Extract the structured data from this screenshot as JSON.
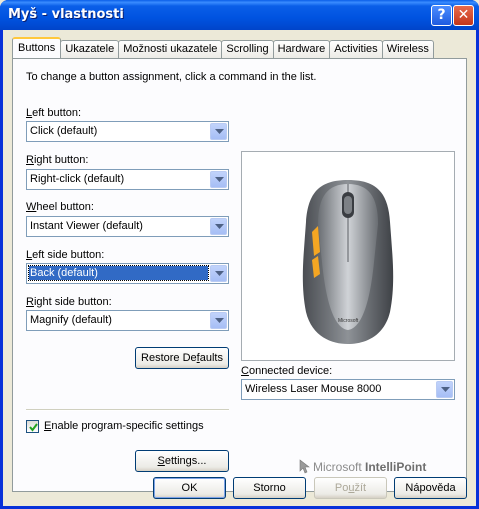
{
  "window": {
    "title": "Myš - vlastnosti",
    "help_glyph": "?",
    "close_glyph": "✕"
  },
  "tabs": [
    {
      "label": "Buttons",
      "active": true
    },
    {
      "label": "Ukazatele"
    },
    {
      "label": "Možnosti ukazatele"
    },
    {
      "label": "Scrolling"
    },
    {
      "label": "Hardware"
    },
    {
      "label": "Activities"
    },
    {
      "label": "Wireless"
    }
  ],
  "buttons_tab": {
    "hint": "To change a button assignment, click a command in the list.",
    "left_button": {
      "label_u": "L",
      "label_rest": "eft button:",
      "value": "Click (default)"
    },
    "right_button": {
      "label_u": "R",
      "label_rest": "ight button:",
      "value": "Right-click (default)"
    },
    "wheel_button": {
      "label_u": "W",
      "label_rest": "heel button:",
      "value": "Instant Viewer (default)"
    },
    "left_side_button": {
      "label_u": "L",
      "label_rest": "eft side button:",
      "value": "Back (default)"
    },
    "right_side_button": {
      "label_u": "R",
      "label_rest": "ight side button:",
      "value": "Magnify (default)"
    },
    "restore_defaults": {
      "pre": "Restore De",
      "u": "f",
      "post": "aults"
    },
    "program_specific": {
      "label_u": "E",
      "label_rest": "nable program-specific settings",
      "checked": true
    },
    "settings": {
      "u": "S",
      "post": "ettings..."
    },
    "connected_device": {
      "label_u": "C",
      "label_rest": "onnected device:",
      "value": "Wireless Laser Mouse 8000"
    },
    "brand": {
      "prefix": "Microsoft ",
      "name": "IntelliPoint"
    }
  },
  "footer": {
    "ok": "OK",
    "cancel": "Storno",
    "apply_pre": "Po",
    "apply_u": "u",
    "apply_post": "žít",
    "help": "Nápověda"
  },
  "colors": {
    "accent": "#0A5FE8",
    "side_buttons": "#F5A623"
  }
}
